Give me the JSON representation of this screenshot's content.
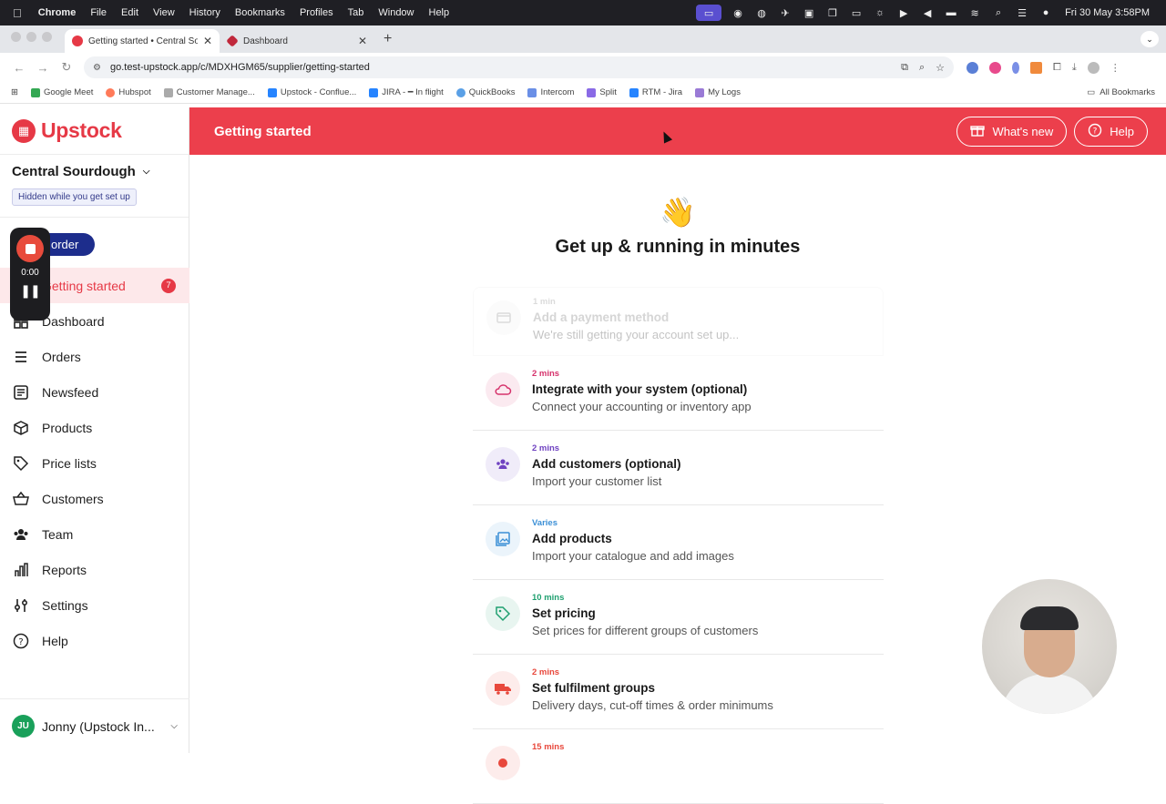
{
  "menubar": {
    "app": "Chrome",
    "items": [
      "File",
      "Edit",
      "View",
      "History",
      "Bookmarks",
      "Profiles",
      "Tab",
      "Window",
      "Help"
    ],
    "datetime": "Fri 30 May  3:58PM"
  },
  "tabs": [
    {
      "title": "Getting started • Central Sou"
    },
    {
      "title": "Dashboard"
    }
  ],
  "address": {
    "url": "go.test-upstock.app/c/MDXHGM65/supplier/getting-started"
  },
  "bookmarks": {
    "items": [
      "Google Meet",
      "Hubspot",
      "Customer Manage...",
      "Upstock - Conflue...",
      "JIRA - ━ In flight",
      "QuickBooks",
      "Intercom",
      "Split",
      "RTM - Jira",
      "My Logs"
    ],
    "all": "All Bookmarks"
  },
  "sidebar": {
    "brand": "Upstock",
    "org_name": "Central Sourdough",
    "hidden_note": "Hidden while you get set up",
    "order_button": "order",
    "items": [
      {
        "label": "Getting started",
        "badge": "7"
      },
      {
        "label": "Dashboard"
      },
      {
        "label": "Orders"
      },
      {
        "label": "Newsfeed"
      },
      {
        "label": "Products"
      },
      {
        "label": "Price lists"
      },
      {
        "label": "Customers"
      },
      {
        "label": "Team"
      },
      {
        "label": "Reports"
      },
      {
        "label": "Settings"
      },
      {
        "label": "Help"
      }
    ],
    "user": {
      "initials": "JU",
      "name": "Jonny (Upstock In..."
    }
  },
  "recorder": {
    "time": "0:00"
  },
  "topbar": {
    "title": "Getting started",
    "whats_new": "What's new",
    "help": "Help"
  },
  "main": {
    "heading": "Get up & running in minutes",
    "steps": [
      {
        "duration": "1 min",
        "title": "Add a payment method",
        "desc": "We're still getting your account set up...",
        "color": "#999999"
      },
      {
        "duration": "2 mins",
        "title": "Integrate with your system (optional)",
        "desc": "Connect your accounting or inventory app",
        "color": "#d6336c"
      },
      {
        "duration": "2 mins",
        "title": "Add customers (optional)",
        "desc": "Import your customer list",
        "color": "#6f42c1"
      },
      {
        "duration": "Varies",
        "title": "Add products",
        "desc": "Import your catalogue and add images",
        "color": "#3b8fd6"
      },
      {
        "duration": "10 mins",
        "title": "Set pricing",
        "desc": "Set prices for different groups of customers",
        "color": "#20a070"
      },
      {
        "duration": "2 mins",
        "title": "Set fulfilment groups",
        "desc": "Delivery days, cut-off times & order minimums",
        "color": "#e8483c"
      },
      {
        "duration": "15 mins",
        "title": "",
        "desc": "",
        "color": "#e8483c"
      }
    ]
  },
  "colors": {
    "brand": "#ec3f4c",
    "order_button": "#1d2d8c",
    "badge": "#e63946"
  }
}
